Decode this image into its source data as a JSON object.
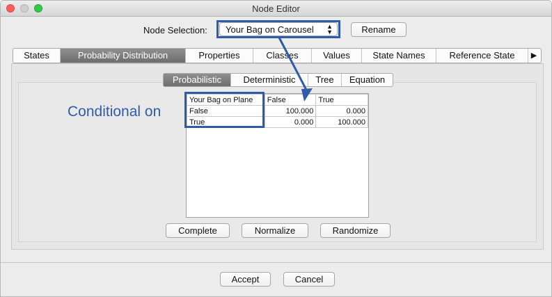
{
  "window": {
    "title": "Node Editor"
  },
  "node_selection": {
    "label": "Node Selection:",
    "value": "Your Bag on Carousel",
    "rename_label": "Rename"
  },
  "tabs": {
    "items": [
      "States",
      "Probability Distribution",
      "Properties",
      "Classes",
      "Values",
      "State Names",
      "Reference State"
    ],
    "selected": "Probability Distribution",
    "more_arrow": "▶"
  },
  "subtabs": {
    "items": [
      "Probabilistic",
      "Deterministic",
      "Tree",
      "Equation"
    ],
    "selected": "Probabilistic"
  },
  "annotation": {
    "text": "Conditional on"
  },
  "cpt": {
    "headers": [
      "Your Bag on Plane",
      "False",
      "True"
    ],
    "rows": [
      {
        "label": "False",
        "values": [
          "100.000",
          "0.000"
        ]
      },
      {
        "label": "True",
        "values": [
          "0.000",
          "100.000"
        ]
      }
    ]
  },
  "actions": {
    "complete": "Complete",
    "normalize": "Normalize",
    "randomize": "Randomize"
  },
  "footer": {
    "accept": "Accept",
    "cancel": "Cancel"
  },
  "colors": {
    "annotation_blue": "#2f5ba8",
    "selected_tab": "#7a7a7a",
    "close": "#fc5f57",
    "maximize": "#35c84a"
  }
}
